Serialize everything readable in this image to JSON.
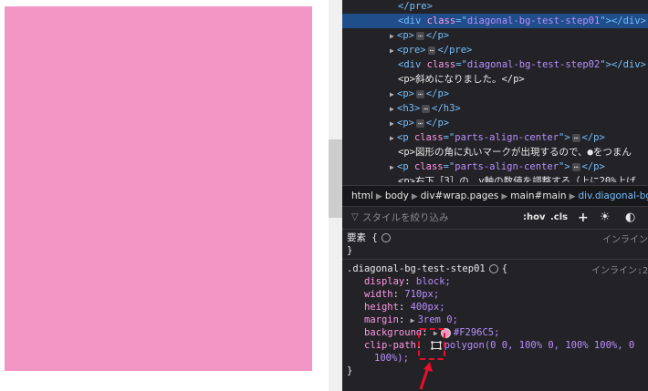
{
  "page": {
    "box_color": "#F296C5"
  },
  "dom_tree": [
    {
      "type": "close",
      "text": "</pre>",
      "indent": 1,
      "selected": false
    },
    {
      "type": "element",
      "tag": "div",
      "attr": "class",
      "value": "diagonal-bg-test-step01",
      "close": "></div>",
      "indent": 1,
      "selected": true
    },
    {
      "type": "collapsed",
      "tag": "p",
      "indent": 0
    },
    {
      "type": "collapsed",
      "tag": "pre",
      "indent": 0
    },
    {
      "type": "element",
      "tag": "div",
      "attr": "class",
      "value": "diagonal-bg-test-step02",
      "close": "></div>",
      "indent": 1,
      "selected": false
    },
    {
      "type": "text",
      "text": "<p>斜めになりました。</p>",
      "indent": 1
    },
    {
      "type": "collapsed",
      "tag": "p",
      "indent": 0
    },
    {
      "type": "collapsed",
      "tag": "h3",
      "indent": 0
    },
    {
      "type": "collapsed",
      "tag": "p",
      "indent": 0
    },
    {
      "type": "collapsed-attr",
      "tag": "p",
      "attr": "class",
      "value": "parts-align-center",
      "indent": 0
    },
    {
      "type": "text",
      "text": "<p>図形の角に丸いマークが出現するので、●をつまん",
      "indent": 1
    },
    {
      "type": "collapsed-attr",
      "tag": "p",
      "attr": "class",
      "value": "parts-align-center",
      "indent": 0
    },
    {
      "type": "text",
      "text": "<p>右下［3］の、y軸の数値を調整する（上に20%上げ",
      "indent": 1
    }
  ],
  "breadcrumb": [
    "html",
    "body",
    "div#wrap.pages",
    "main#main",
    "div.diagonal-bg"
  ],
  "filter": {
    "placeholder": "スタイルを絞り込み",
    "hov": ":hov",
    "cls": ".cls",
    "add": "+"
  },
  "element_rule": {
    "selector": "要素 {",
    "source": "インライン",
    "close": "}"
  },
  "rule": {
    "selector": ".diagonal-bg-test-step01",
    "source": "インライン:2",
    "declarations": [
      {
        "prop": "display",
        "value": "block;"
      },
      {
        "prop": "width",
        "value": "710px;"
      },
      {
        "prop": "height",
        "value": "400px;"
      },
      {
        "prop": "margin",
        "value": "3rem 0;"
      },
      {
        "prop": "background",
        "value": "#F296C5;"
      },
      {
        "prop": "clip-path",
        "value": "polygon(0 0, 100% 0, 100% 100%, 0"
      },
      {
        "prop": "",
        "value": "100%);"
      }
    ],
    "close": "}"
  },
  "colors": {
    "highlight": "#e8102a",
    "selected_bg": "#204e8a",
    "tag": "#75bfff",
    "attr": "#ff97e5",
    "value": "#b98eff"
  }
}
